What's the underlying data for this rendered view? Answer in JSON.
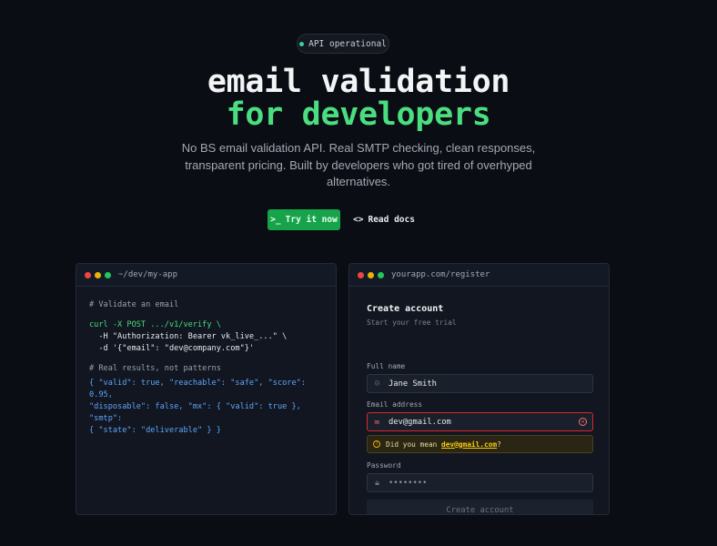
{
  "badge": {
    "label": "API operational"
  },
  "hero": {
    "title_line1": "email validation",
    "title_line2": "for developers",
    "subtitle": "No BS email validation API. Real SMTP checking, clean responses, transparent pricing. Built by developers who got tired of overhyped alternatives."
  },
  "actions": {
    "primary_icon": ">_",
    "primary_label": "Try it now",
    "secondary_icon": "<>",
    "secondary_label": "Read docs"
  },
  "terminal": {
    "path": "~/dev/my-app",
    "comment1": "# Validate an email",
    "cmd": "curl -X POST .../v1/verify \\",
    "line2": "  -H \"Authorization: Bearer vk_live_...\" \\",
    "line3": "  -d '{\"email\": \"dev@company.com\"}'",
    "comment2": "# Real results, not patterns",
    "json1": "{ \"valid\": true, \"reachable\": \"safe\", \"score\": 0.95,",
    "json2": "\"disposable\": false, \"mx\": { \"valid\": true }, \"smtp\":",
    "json3": "{ \"state\": \"deliverable\" } }"
  },
  "browser": {
    "url": "yourapp.com/register",
    "heading": "Create account",
    "subheading": "Start your free trial",
    "fullname_label": "Full name",
    "fullname_value": "Jane Smith",
    "email_label": "Email address",
    "email_value": "dev@gmail.com",
    "suggest_prefix": "Did you mean ",
    "suggest_link": "dev@gmail.com",
    "suggest_suffix": "?",
    "password_label": "Password",
    "password_value": "••••••••",
    "submit_label": "Create account"
  },
  "colors": {
    "accent": "#4ade80",
    "button": "#16a34a",
    "error": "#dc2626",
    "warning": "#eab308"
  }
}
